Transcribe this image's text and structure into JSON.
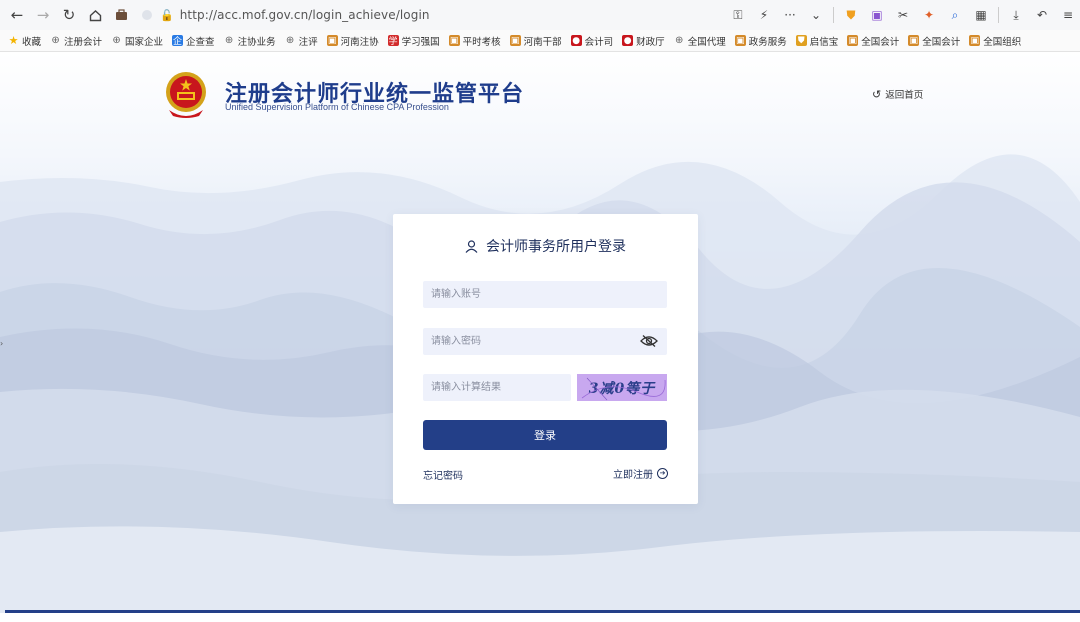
{
  "browser": {
    "url": "http://acc.mof.gov.cn/login_achieve/login",
    "bookmarks": [
      {
        "label": "收藏",
        "icon": "star-icon"
      },
      {
        "label": "注册会计",
        "icon": "globe-icon"
      },
      {
        "label": "国家企业",
        "icon": "globe-icon"
      },
      {
        "label": "企查查",
        "icon": "qichacha-icon"
      },
      {
        "label": "注协业务",
        "icon": "globe-icon"
      },
      {
        "label": "注评",
        "icon": "globe-icon"
      },
      {
        "label": "河南注协",
        "icon": "site-icon"
      },
      {
        "label": "学习强国",
        "icon": "xuexi-icon"
      },
      {
        "label": "平时考核",
        "icon": "site-icon"
      },
      {
        "label": "河南干部",
        "icon": "site-icon"
      },
      {
        "label": "会计司",
        "icon": "emblem-icon"
      },
      {
        "label": "财政厅",
        "icon": "emblem-icon"
      },
      {
        "label": "全国代理",
        "icon": "globe-icon"
      },
      {
        "label": "政务服务",
        "icon": "site-icon"
      },
      {
        "label": "启信宝",
        "icon": "shield-icon"
      },
      {
        "label": "全国会计",
        "icon": "site-icon"
      },
      {
        "label": "全国会计",
        "icon": "site-icon"
      },
      {
        "label": "全国组织",
        "icon": "site-icon"
      }
    ]
  },
  "header": {
    "title_cn": "注册会计师行业统一监管平台",
    "title_en": "Unified Supervision Platform of Chinese CPA Profession",
    "home_link": "返回首页"
  },
  "login": {
    "title": "会计师事务所用户登录",
    "account_placeholder": "请输入账号",
    "password_placeholder": "请输入密码",
    "captcha_placeholder": "请输入计算结果",
    "captcha_text": "3减0等于",
    "submit_label": "登录",
    "forgot_label": "忘记密码",
    "register_label": "立即注册"
  },
  "colors": {
    "brand": "#1f3d8c",
    "button": "#233f88",
    "input_bg": "#eef1fb",
    "captcha_bg": "#c8a8ef"
  }
}
